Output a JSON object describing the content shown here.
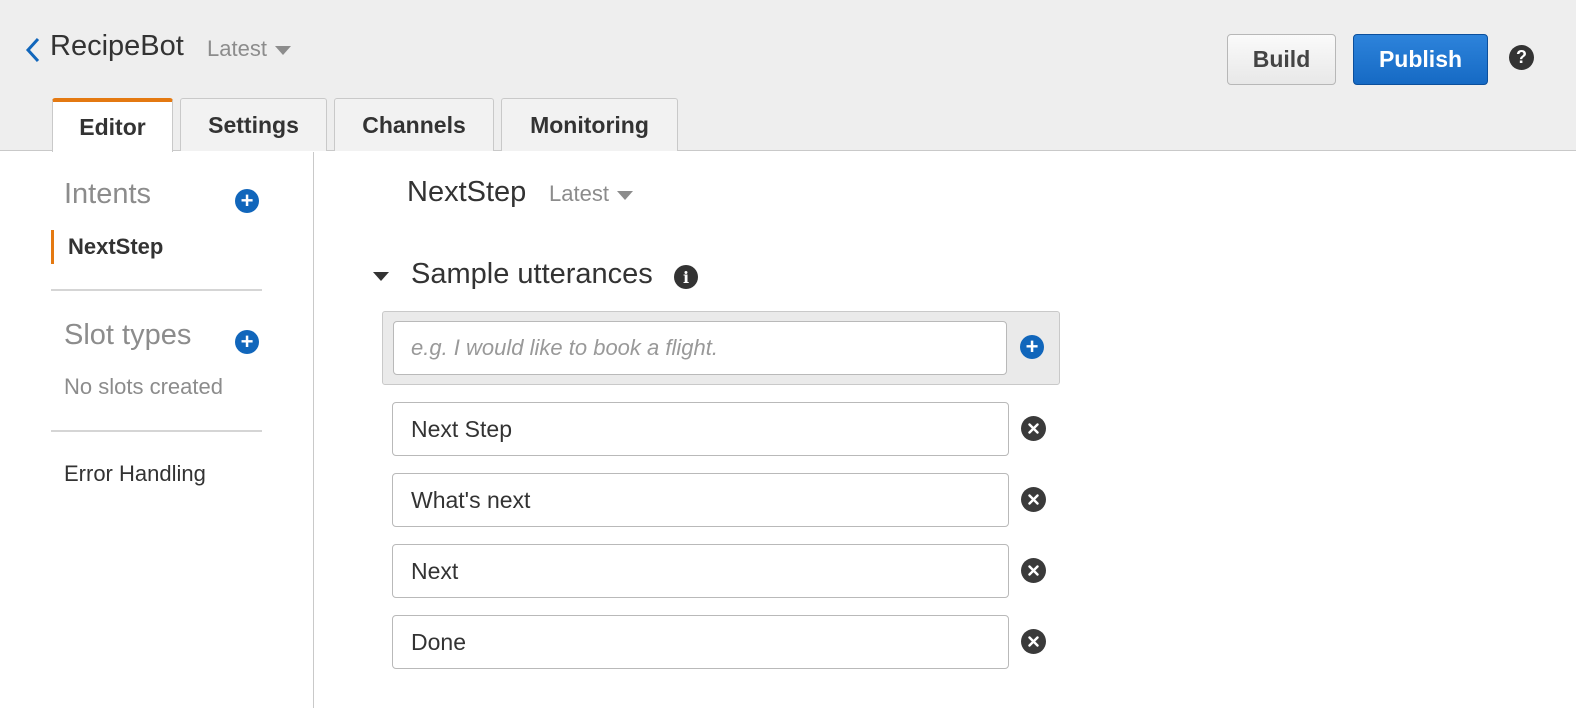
{
  "header": {
    "bot_name": "RecipeBot",
    "version": "Latest",
    "build_label": "Build",
    "publish_label": "Publish",
    "help_label": "?"
  },
  "tabs": [
    {
      "label": "Editor",
      "active": true
    },
    {
      "label": "Settings",
      "active": false
    },
    {
      "label": "Channels",
      "active": false
    },
    {
      "label": "Monitoring",
      "active": false
    }
  ],
  "sidebar": {
    "intents_title": "Intents",
    "intents": [
      {
        "label": "NextStep",
        "selected": true
      }
    ],
    "slot_types_title": "Slot types",
    "no_slots_text": "No slots created",
    "error_handling": "Error Handling"
  },
  "main": {
    "intent_name": "NextStep",
    "intent_version": "Latest",
    "section_title": "Sample utterances",
    "new_utterance_placeholder": "e.g. I would like to book a flight.",
    "utterances": [
      "Next Step",
      "What's next",
      "Next",
      "Done"
    ]
  },
  "colors": {
    "accent_orange": "#e47911",
    "primary_blue": "#1166bb",
    "header_bg": "#eeeeee"
  }
}
